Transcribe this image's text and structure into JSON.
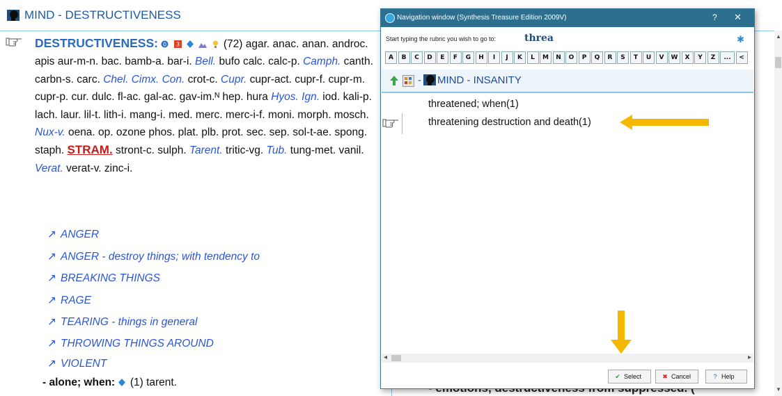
{
  "header": {
    "title": "MIND - DESTRUCTIVENESS"
  },
  "main": {
    "rubric": "DESTRUCTIVENESS:",
    "count": "(72)",
    "remedies_text": [
      {
        "t": "agar. anac. anan.",
        "s": "n"
      },
      {
        "t": "androc. apis aur-m-n. bac. bamb-a. bar-i. ",
        "s": "n"
      },
      {
        "t": "Bell.",
        "s": "b"
      },
      {
        "t": " bufo calc.",
        "s": "n"
      },
      {
        "t": "calc-p. ",
        "s": "n"
      },
      {
        "t": "Camph.",
        "s": "b"
      },
      {
        "t": " canth. carbn-s. carc. ",
        "s": "n"
      },
      {
        "t": "Chel. Cimx. Con.",
        "s": "b"
      },
      {
        "t": " crot-c.",
        "s": "n"
      },
      {
        "t": "Cupr.",
        "s": "b"
      },
      {
        "t": " cupr-act. cupr-f. cupr-m. cupr-p. cur. dulc. fl-ac. gal-ac.",
        "s": "n"
      },
      {
        "t": "gav-im.ᴺ hep. hura ",
        "s": "n"
      },
      {
        "t": "Hyos. Ign.",
        "s": "b"
      },
      {
        "t": " iod. kali-p. lach. laur. lil-t. lith-i.",
        "s": "n"
      },
      {
        "t": "mang-i. med. merc. merc-i-f. moni. morph. mosch. ",
        "s": "n"
      },
      {
        "t": "Nux-v.",
        "s": "b"
      },
      {
        "t": " oena. op. ozone phos. plat. plb. prot. sec. sep. sol-t-ae.",
        "s": "n"
      },
      {
        "t": " spong. staph. ",
        "s": "n"
      },
      {
        "t": "STRAM.",
        "s": "r"
      },
      {
        "t": " stront-c. sulph. ",
        "s": "n"
      },
      {
        "t": "Tarent.",
        "s": "b"
      },
      {
        "t": " tritic-vg. ",
        "s": "n"
      },
      {
        "t": "Tub.",
        "s": "b"
      },
      {
        "t": " tung-met. vanil. ",
        "s": "n"
      },
      {
        "t": "Verat.",
        "s": "b"
      },
      {
        "t": " verat-v. zinc-i.",
        "s": "n"
      }
    ],
    "xrefs": [
      "ANGER",
      "ANGER - destroy things; with tendency to",
      "BREAKING THINGS",
      "RAGE",
      "TEARING - things in general",
      "THROWING THINGS AROUND",
      "VIOLENT"
    ],
    "subrubric_label": "- alone; when:",
    "subrubric_rest": "(1) tarent.",
    "right_partial": "- emotions, destructiveness from suppressed. ("
  },
  "dialog": {
    "title": "Navigation window (Synthesis Treasure Edition 2009V)",
    "help_glyph": "?",
    "close_glyph": "✕",
    "search_label": "Start typing the rubric you wish to go to:",
    "search_value": "threa",
    "letters": [
      "A",
      "B",
      "C",
      "D",
      "E",
      "F",
      "G",
      "H",
      "I",
      "J",
      "K",
      "L",
      "M",
      "N",
      "O",
      "P",
      "Q",
      "R",
      "S",
      "T",
      "U",
      "V",
      "W",
      "X",
      "Y",
      "Z",
      "...",
      "<"
    ],
    "nav_dash": "-",
    "nav_title": "MIND - INSANITY",
    "items": [
      "threatened; when(1)",
      "threatening destruction and death(1)"
    ],
    "buttons": {
      "select": "Select",
      "cancel": "Cancel",
      "help": "Help"
    }
  },
  "colors": {
    "accent_yellow": "#f5b700",
    "title_bar": "#2d6f8f",
    "rubric_blue": "#2a6bbf",
    "remedy_red": "#c41a1a"
  }
}
